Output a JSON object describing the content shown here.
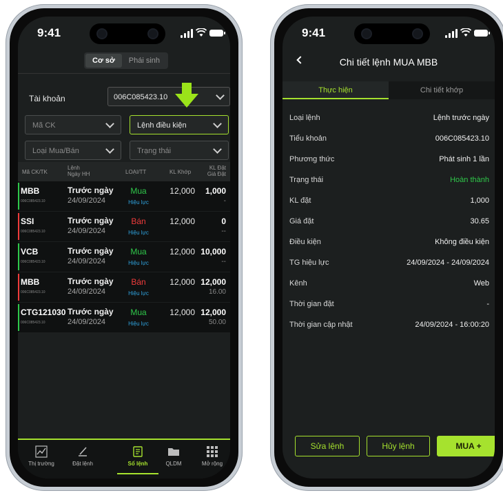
{
  "colors": {
    "accent": "#a6e22e",
    "buy": "#2fc84a",
    "sell": "#ef3b3b",
    "status_valid": "#2fa3df",
    "background": "#1c1f1f"
  },
  "status_bar": {
    "time": "9:41"
  },
  "order_book": {
    "segments": [
      {
        "label": "Cơ sở",
        "selected": true
      },
      {
        "label": "Phái sinh",
        "selected": false
      }
    ],
    "account_label": "Tài khoản",
    "account_value": "006C085423.10",
    "filters": {
      "symbol_placeholder": "Mã CK",
      "order_type_value": "Lệnh điều kiện",
      "side_placeholder": "Loại Mua/Bán",
      "status_placeholder": "Trạng thái"
    },
    "columns": {
      "symbol": "Mã CK/TK",
      "order_line1": "Lệnh",
      "order_line2": "Ngày HH",
      "type": "LOẠI/TT",
      "matched": "KL Khớp",
      "qty_line1": "KL Đặt",
      "qty_line2": "Giá Đặt"
    },
    "rows": [
      {
        "symbol": "MBB",
        "account": "006C085423.10",
        "order": "Trước ngày",
        "date": "24/09/2024",
        "side": "Mua",
        "side_color": "#2fc84a",
        "status": "Hiệu lực",
        "matched": "12,000",
        "qty": "1,000",
        "price": "-"
      },
      {
        "symbol": "SSI",
        "account": "006C085423.10",
        "order": "Trước ngày",
        "date": "24/09/2024",
        "side": "Bán",
        "side_color": "#ef3b3b",
        "status": "Hiệu lực",
        "matched": "12,000",
        "qty": "0",
        "price": "--"
      },
      {
        "symbol": "VCB",
        "account": "006C085423.10",
        "order": "Trước ngày",
        "date": "24/09/2024",
        "side": "Mua",
        "side_color": "#2fc84a",
        "status": "Hiệu lực",
        "matched": "12,000",
        "qty": "10,000",
        "price": "--"
      },
      {
        "symbol": "MBB",
        "account": "006C085423.10",
        "order": "Trước ngày",
        "date": "24/09/2024",
        "side": "Bán",
        "side_color": "#ef3b3b",
        "status": "Hiệu lực",
        "matched": "12,000",
        "qty": "12,000",
        "price": "16.00"
      },
      {
        "symbol": "CTG121030",
        "account": "006C085423.10",
        "order": "Trước ngày",
        "date": "24/09/2024",
        "side": "Mua",
        "side_color": "#2fc84a",
        "status": "Hiệu lực",
        "matched": "12,000",
        "qty": "12,000",
        "price": "50.00"
      }
    ],
    "bottom_nav": [
      {
        "label": "Thị trường",
        "icon": "market-chart-icon",
        "active": false
      },
      {
        "label": "Đặt lệnh",
        "icon": "place-order-icon",
        "active": false
      },
      {
        "label": "Sổ lệnh",
        "icon": "order-book-icon",
        "active": true
      },
      {
        "label": "QLDM",
        "icon": "folder-icon",
        "active": false
      },
      {
        "label": "Mở rộng",
        "icon": "grid-icon",
        "active": false
      }
    ]
  },
  "order_detail": {
    "title": "Chi tiết lệnh MUA MBB",
    "tabs": [
      {
        "label": "Thực hiện",
        "selected": true
      },
      {
        "label": "Chi tiết khớp",
        "selected": false
      }
    ],
    "fields": [
      {
        "key": "Loại lệnh",
        "value": "Lệnh trước ngày"
      },
      {
        "key": "Tiểu khoản",
        "value": "006C085423.10"
      },
      {
        "key": "Phương thức",
        "value": "Phát sinh 1 lần"
      },
      {
        "key": "Trạng thái",
        "value": "Hoàn thành",
        "value_color": "#2fc84a"
      },
      {
        "key": "KL đặt",
        "value": "1,000"
      },
      {
        "key": "Giá đặt",
        "value": "30.65"
      },
      {
        "key": "Điều kiện",
        "value": "Không điều kiện"
      },
      {
        "key": "TG hiệu lực",
        "value": "24/09/2024 - 24/09/2024"
      },
      {
        "key": "Kênh",
        "value": "Web"
      },
      {
        "key": "Thời gian đặt",
        "value": "-"
      },
      {
        "key": "Thời gian cập nhật",
        "value": "24/09/2024 - 16:00:20"
      }
    ],
    "buttons": {
      "edit": "Sửa lệnh",
      "cancel": "Hủy lệnh",
      "buy_more": "MUA +"
    }
  }
}
